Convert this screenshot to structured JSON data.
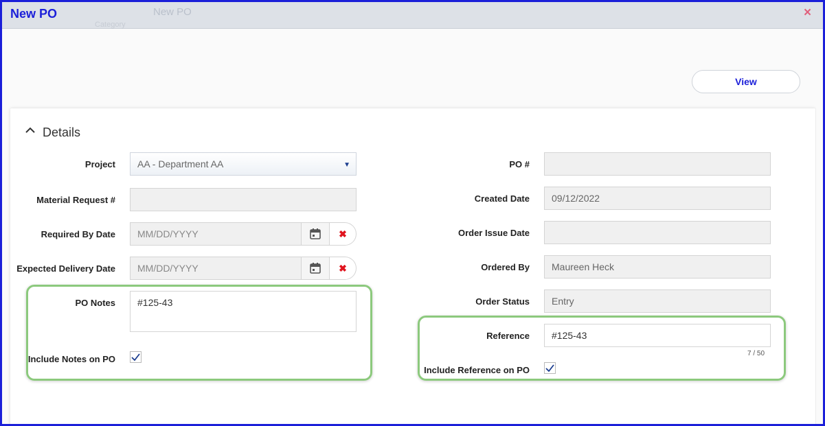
{
  "window": {
    "title": "New PO",
    "ghost_title": "New PO",
    "ghost_sub": "Category",
    "close_icon": "close-icon"
  },
  "toolbar": {
    "view_label": "View"
  },
  "details": {
    "section_title": "Details",
    "project": {
      "label": "Project",
      "value": "AA - Department AA",
      "arrow": "▼"
    },
    "material_request": {
      "label": "Material Request #",
      "value": ""
    },
    "required_by_date": {
      "label": "Required By Date",
      "placeholder": "MM/DD/YYYY"
    },
    "expected_delivery_date": {
      "label": "Expected Delivery Date",
      "placeholder": "MM/DD/YYYY"
    },
    "po_notes": {
      "label": "PO Notes",
      "value": "#125-43"
    },
    "include_notes": {
      "label": "Include Notes on PO",
      "checked": true
    },
    "po_number": {
      "label": "PO #",
      "value": ""
    },
    "created_date": {
      "label": "Created Date",
      "value": "09/12/2022"
    },
    "order_issue_date": {
      "label": "Order Issue Date",
      "value": ""
    },
    "ordered_by": {
      "label": "Ordered By",
      "value": "Maureen Heck"
    },
    "order_status": {
      "label": "Order Status",
      "value": "Entry"
    },
    "reference": {
      "label": "Reference",
      "value": "#125-43",
      "counter": "7 / 50"
    },
    "include_reference": {
      "label": "Include Reference on PO",
      "checked": true
    }
  },
  "colors": {
    "title": "#1b1fd9",
    "highlight": "#8cc97d",
    "clear_icon": "#e0141e",
    "close_icon": "#e0607c"
  }
}
